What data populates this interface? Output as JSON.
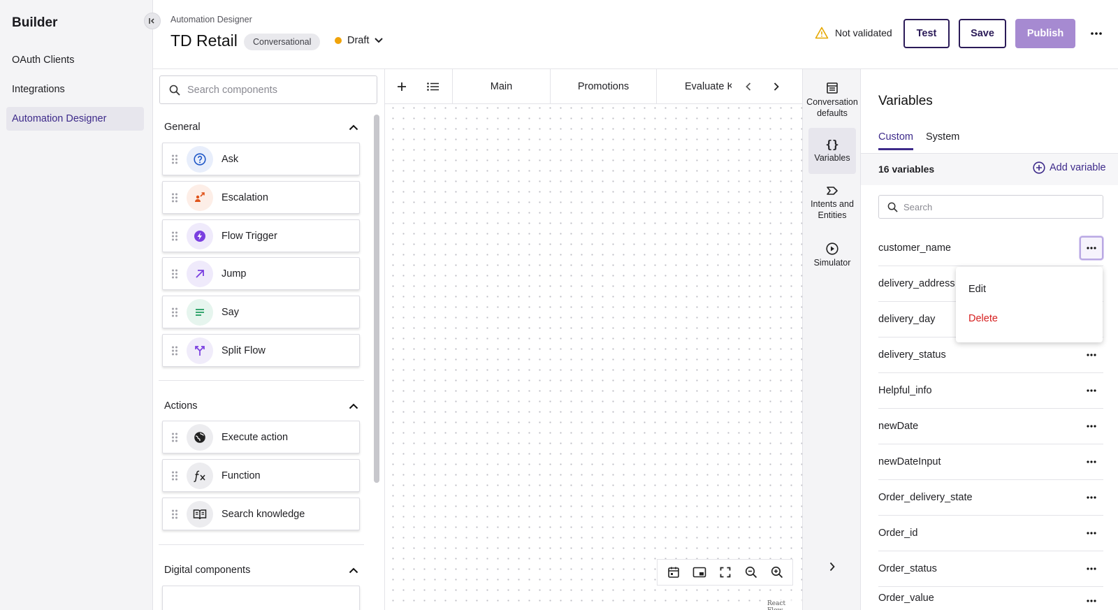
{
  "sidebar": {
    "brand": "Builder",
    "items": [
      {
        "label": "OAuth Clients",
        "active": false
      },
      {
        "label": "Integrations",
        "active": false
      },
      {
        "label": "Automation Designer",
        "active": true
      }
    ]
  },
  "header": {
    "breadcrumb": "Automation Designer",
    "title": "TD Retail",
    "type_chip": "Conversational",
    "status": "Draft",
    "validation": "Not validated",
    "buttons": {
      "test": "Test",
      "save": "Save",
      "publish": "Publish"
    }
  },
  "components": {
    "search_placeholder": "Search components",
    "sections": [
      {
        "title": "General",
        "items": [
          {
            "label": "Ask",
            "icon": "question-circle-icon"
          },
          {
            "label": "Escalation",
            "icon": "escalation-person-icon"
          },
          {
            "label": "Flow Trigger",
            "icon": "lightning-bolt-icon"
          },
          {
            "label": "Jump",
            "icon": "arrow-up-right-icon"
          },
          {
            "label": "Say",
            "icon": "text-lines-icon"
          },
          {
            "label": "Split Flow",
            "icon": "split-arrows-icon"
          }
        ]
      },
      {
        "title": "Actions",
        "items": [
          {
            "label": "Execute action",
            "icon": "globe-icon"
          },
          {
            "label": "Function",
            "icon": "function-fx-icon"
          },
          {
            "label": "Search knowledge",
            "icon": "open-book-icon"
          }
        ]
      },
      {
        "title": "Digital components",
        "items": []
      }
    ]
  },
  "canvas": {
    "flow_tabs": [
      "Main",
      "Promotions",
      "Evaluate K"
    ],
    "attribution": "React Flow"
  },
  "rail": {
    "items": [
      {
        "label": "Conversation defaults",
        "icon": "table-list-icon",
        "active": false
      },
      {
        "label": "Variables",
        "icon": "curly-braces-icon",
        "active": true
      },
      {
        "label": "Intents and Entities",
        "icon": "tag-icon",
        "active": false
      },
      {
        "label": "Simulator",
        "icon": "play-circle-icon",
        "active": false
      }
    ]
  },
  "variables": {
    "title": "Variables",
    "tabs": [
      {
        "label": "Custom",
        "active": true
      },
      {
        "label": "System",
        "active": false
      }
    ],
    "count_label": "16 variables",
    "add_label": "Add variable",
    "search_placeholder": "Search",
    "list": [
      "customer_name",
      "delivery_address",
      "delivery_day",
      "delivery_status",
      "Helpful_info",
      "newDate",
      "newDateInput",
      "Order_delivery_state",
      "Order_id",
      "Order_status",
      "Order_value"
    ],
    "menu": {
      "edit": "Edit",
      "delete": "Delete"
    }
  },
  "colors": {
    "accent": "#3d2a8a",
    "publish": "#a68ad1",
    "danger": "#d62020",
    "draft_dot": "#f0a30a"
  }
}
